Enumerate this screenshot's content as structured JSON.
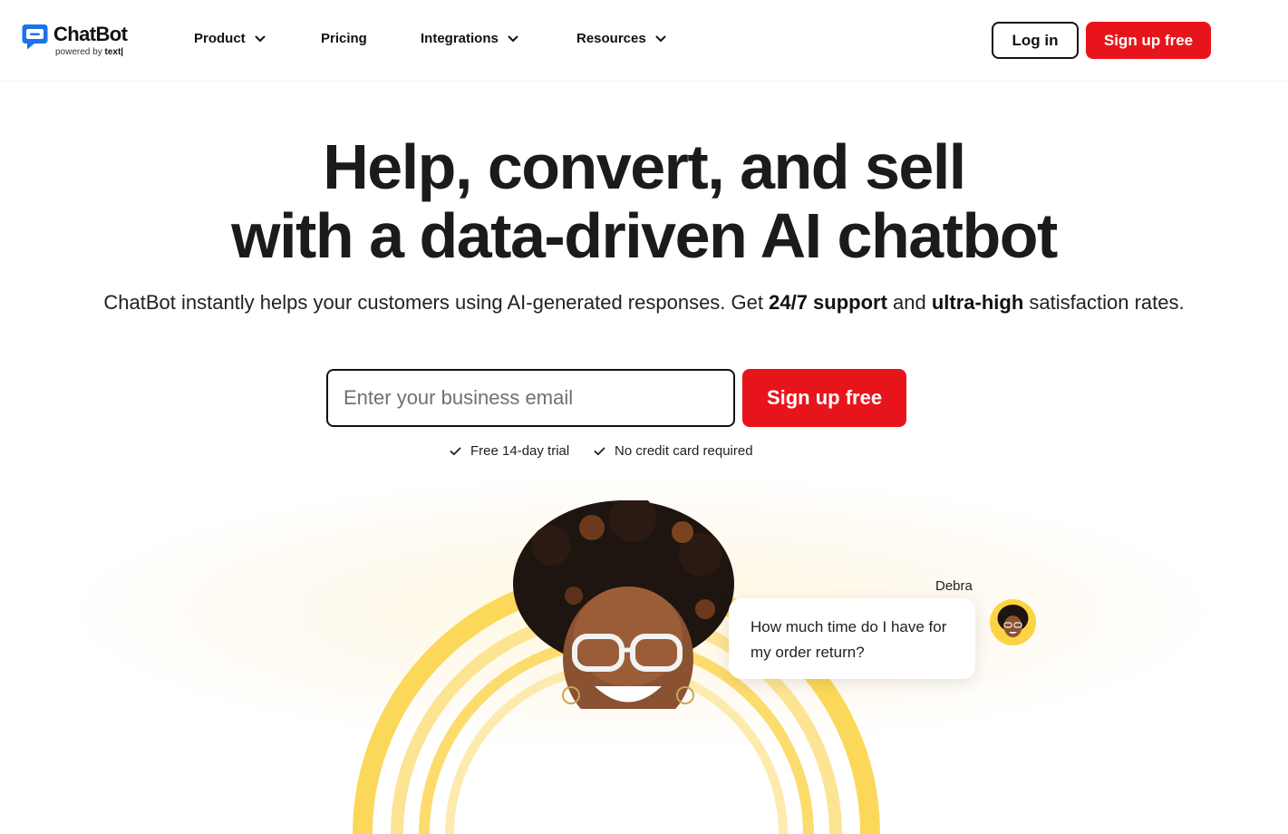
{
  "brand": {
    "name": "ChatBot",
    "powered_by_prefix": "powered by",
    "powered_by_brand": "text|",
    "accent_color": "#e8141b",
    "logo_color": "#1a73e8"
  },
  "nav": {
    "items": [
      {
        "label": "Product",
        "has_dropdown": true
      },
      {
        "label": "Pricing",
        "has_dropdown": false
      },
      {
        "label": "Integrations",
        "has_dropdown": true
      },
      {
        "label": "Resources",
        "has_dropdown": true
      }
    ],
    "login_label": "Log in",
    "signup_label": "Sign up free"
  },
  "hero": {
    "title_line1": "Help, convert, and sell",
    "title_line2": "with a data-driven AI chatbot",
    "sub_part1": "ChatBot instantly helps your customers using AI-generated responses. Get ",
    "sub_bold1": "24/7 support",
    "sub_part2": " and ",
    "sub_bold2": "ultra-high",
    "sub_part3": " satisfaction rates.",
    "email_placeholder": "Enter your business email",
    "email_value": "",
    "signup_label": "Sign up free",
    "perks": [
      "Free 14-day trial",
      "No credit card required"
    ]
  },
  "chat_preview": {
    "sender": "Debra",
    "message": "How much time do I have for my order return?"
  }
}
